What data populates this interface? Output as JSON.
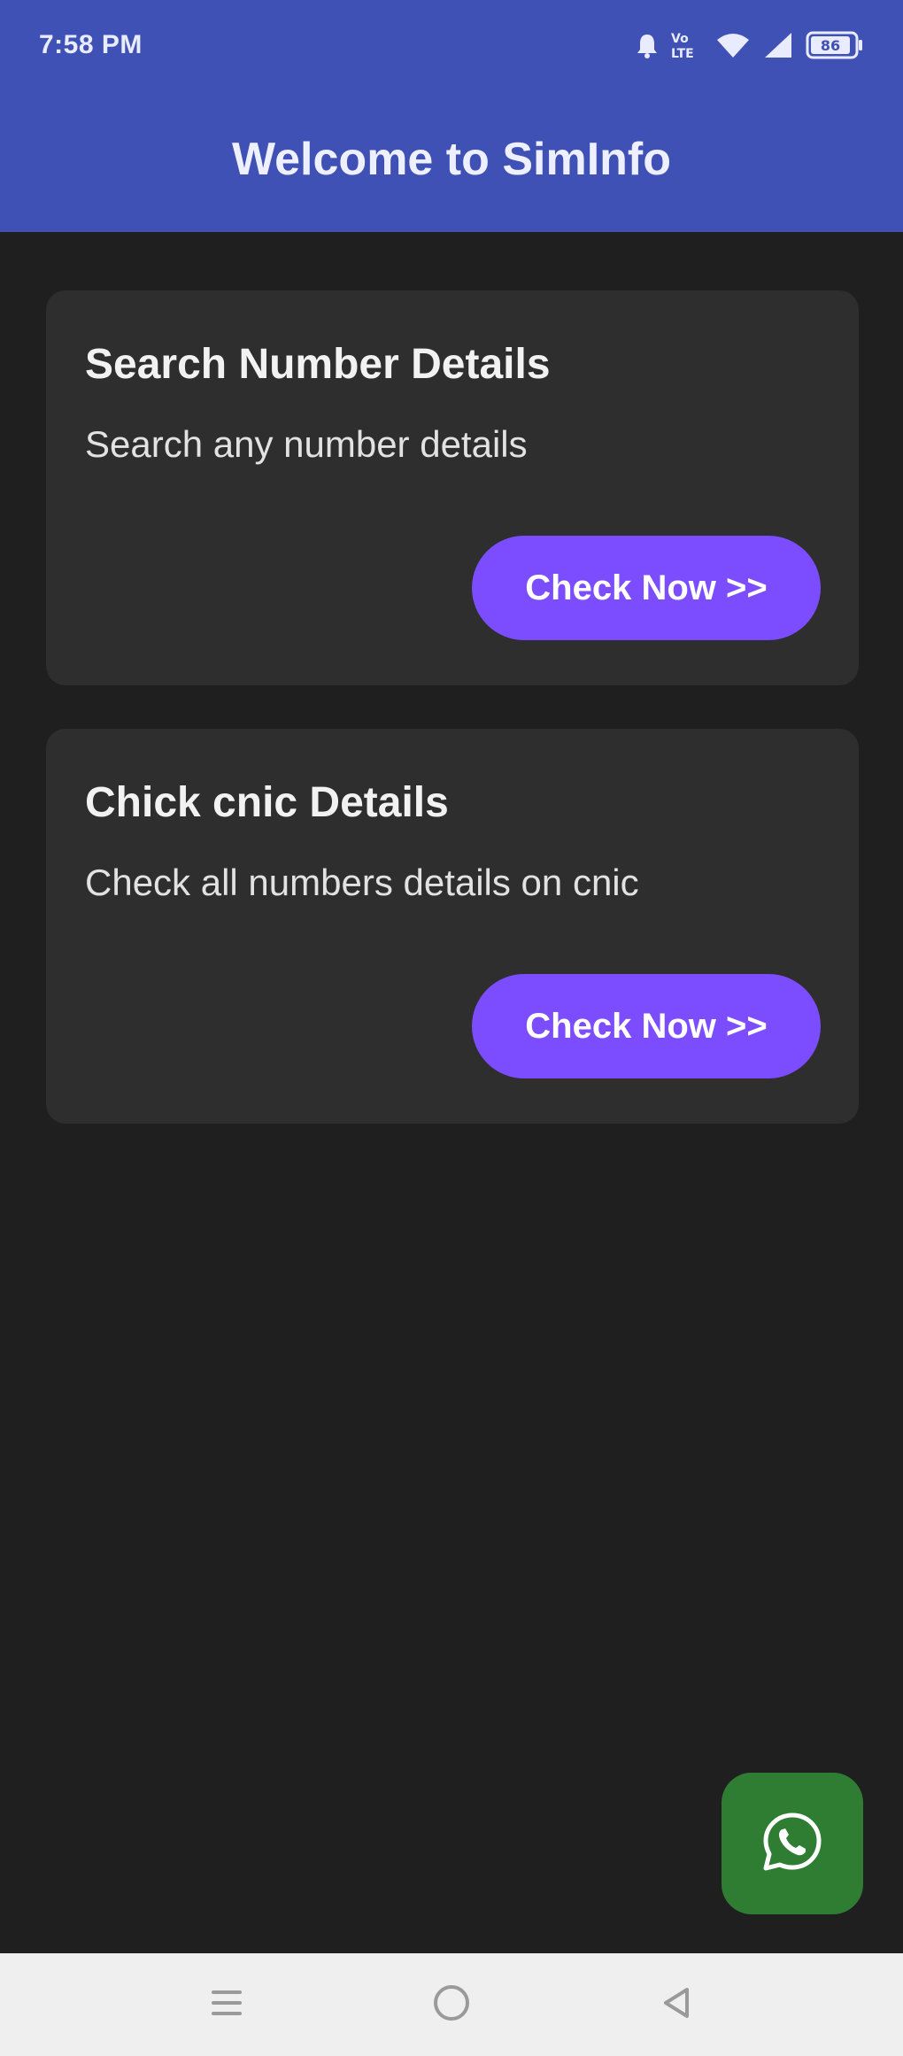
{
  "status_bar": {
    "time": "7:58 PM",
    "battery_level": "86",
    "icons": [
      "alarm-icon",
      "volte-icon",
      "wifi-icon",
      "signal-icon",
      "battery-icon"
    ]
  },
  "app_bar": {
    "title": "Welcome to SimInfo",
    "color": "#3f51b5"
  },
  "cards": [
    {
      "title": "Search Number Details",
      "description": "Search any number details",
      "button_label": "Check Now >>"
    },
    {
      "title": "Chick cnic Details",
      "description": "Check all numbers details on cnic",
      "button_label": "Check Now >>"
    }
  ],
  "fab": {
    "icon": "whatsapp-icon",
    "color": "#2e7d32"
  },
  "nav_bar": {
    "icons": [
      "menu-icon",
      "home-icon",
      "back-icon"
    ]
  },
  "colors": {
    "background": "#1f1f1f",
    "card": "#2e2e2e",
    "accent": "#7c4dff"
  }
}
